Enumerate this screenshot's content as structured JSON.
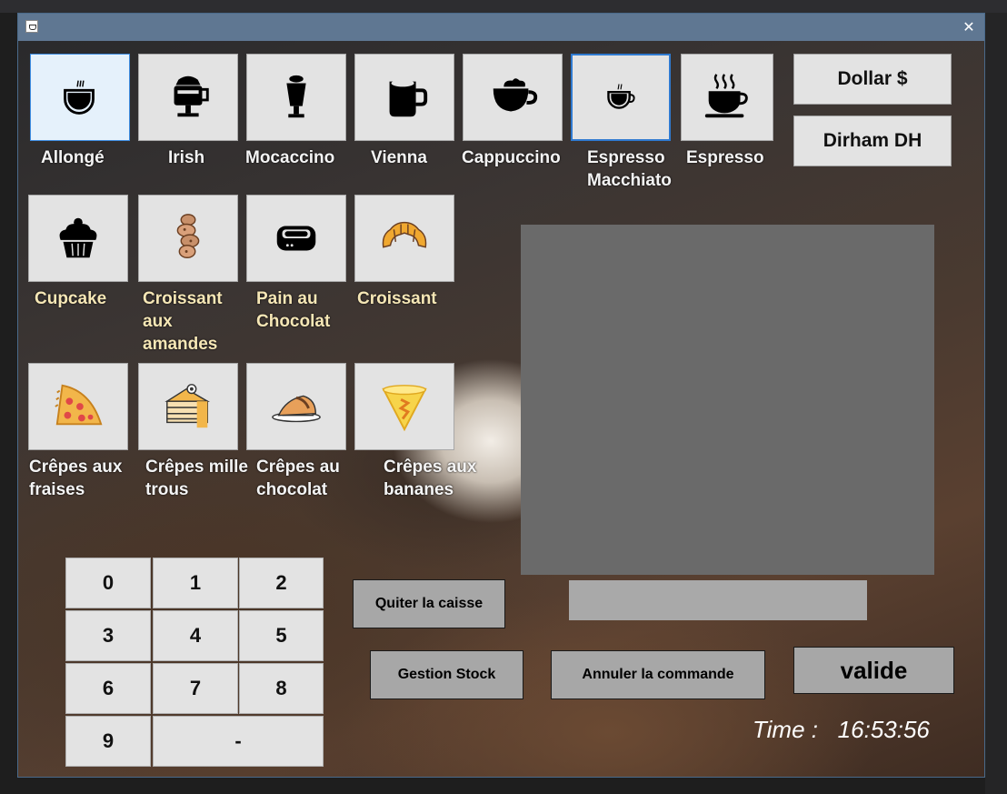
{
  "window": {
    "close_glyph": "✕",
    "app_icon": "coffee-cup-icon"
  },
  "drinks": [
    {
      "label": "Allongé",
      "icon": "coffee-cup-icon"
    },
    {
      "label": "Irish",
      "icon": "irish-coffee-icon"
    },
    {
      "label": "Mocaccino",
      "icon": "tall-glass-icon"
    },
    {
      "label": "Vienna",
      "icon": "mug-icon"
    },
    {
      "label": "Cappuccino",
      "icon": "cappuccino-cup-icon"
    },
    {
      "label": "Espresso Macchiato",
      "icon": "macchiato-cup-icon"
    },
    {
      "label": "Espresso",
      "icon": "steaming-cup-icon"
    }
  ],
  "pastries": [
    {
      "label": "Cupcake",
      "icon": "cupcake-icon"
    },
    {
      "label": "Croissant aux amandes",
      "icon": "almond-croissant-icon"
    },
    {
      "label": "Pain au Chocolat",
      "icon": "pain-au-chocolat-icon"
    },
    {
      "label": "Croissant",
      "icon": "croissant-icon"
    }
  ],
  "crepes": [
    {
      "label": "Crêpes aux fraises",
      "icon": "strawberry-crepe-icon"
    },
    {
      "label": "Crêpes mille trous",
      "icon": "cake-slice-icon"
    },
    {
      "label": "Crêpes au chocolat",
      "icon": "chocolate-crepe-icon"
    },
    {
      "label": "Crêpes aux bananes",
      "icon": "banana-crepe-icon"
    }
  ],
  "currency": {
    "dollar": "Dollar $",
    "dirham": "Dirham DH"
  },
  "keypad": [
    "0",
    "1",
    "2",
    "3",
    "4",
    "5",
    "6",
    "7",
    "8",
    "9",
    "-"
  ],
  "actions": {
    "quit": "Quiter la caisse",
    "stock": "Gestion Stock",
    "cancel": "Annuler la commande",
    "validate": "valide"
  },
  "time": {
    "label": "Time :",
    "value": "16:53:56"
  },
  "colors": {
    "tile_bg": "#e3e3e3",
    "selected_border": "#2f7ad0",
    "pastry_label": "#f6e7b6",
    "display_bg": "#6a6a6a"
  }
}
